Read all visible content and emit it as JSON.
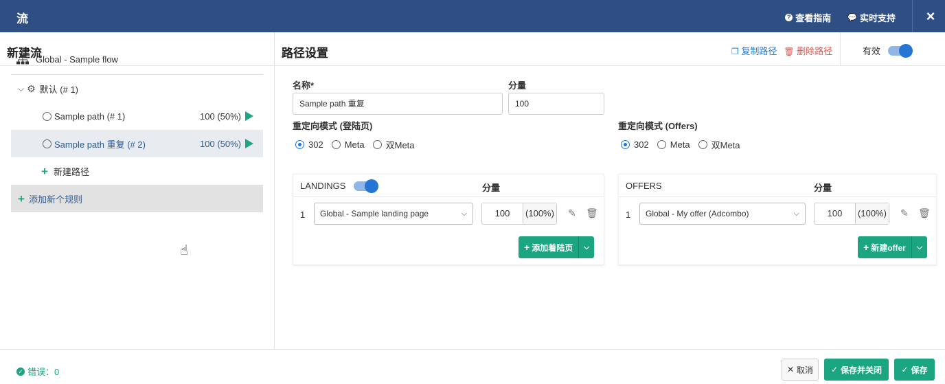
{
  "topbar": {
    "title": "流",
    "guide_label": "查看指南",
    "support_label": "实时支持",
    "close_icon": "×"
  },
  "left": {
    "title": "新建流",
    "flow_label": "Global - Sample flow",
    "rule_label": "默认 (# 1)",
    "paths": [
      {
        "label": "Sample path (# 1)",
        "value": "100 (50%)"
      },
      {
        "label": "Sample path 重复 (# 2)",
        "value": "100 (50%)"
      }
    ],
    "new_path_label": "新建路径",
    "add_rule_label": "添加新个规则"
  },
  "right": {
    "title": "路径设置",
    "copy_label": "复制路径",
    "delete_label": "删除路径",
    "active_label": "有效",
    "name_label": "名称*",
    "name_value": "Sample path 重复",
    "share_label": "分量",
    "share_value": "100",
    "redirect_landing_label": "重定向模式 (登陆页)",
    "redirect_offers_label": "重定向模式 (Offers)",
    "redirect_options": [
      "302",
      "Meta",
      "双Meta"
    ],
    "redirect_landing_selected": "302",
    "redirect_offers_selected": "302"
  },
  "landings": {
    "title": "LANDINGS",
    "share_header": "分量",
    "row_num": "1",
    "select_value": "Global - Sample landing page",
    "weight": "100",
    "percent": "(100%)",
    "add_label": "添加着陆页"
  },
  "offers": {
    "title": "OFFERS",
    "share_header": "分量",
    "row_num": "1",
    "select_value": "Global - My offer (Adcombo)",
    "weight": "100",
    "percent": "(100%)",
    "add_label": "新建offer"
  },
  "footer": {
    "errors_label": "错误：0",
    "cancel_label": "取消",
    "save_close_label": "保存并关闭",
    "save_label": "保存"
  },
  "colors": {
    "header_bg": "#2f4f84",
    "accent_green": "#1ca581",
    "link_blue": "#2878c8",
    "danger_red": "#d9534f",
    "toggle_blue": "#2476d2"
  }
}
